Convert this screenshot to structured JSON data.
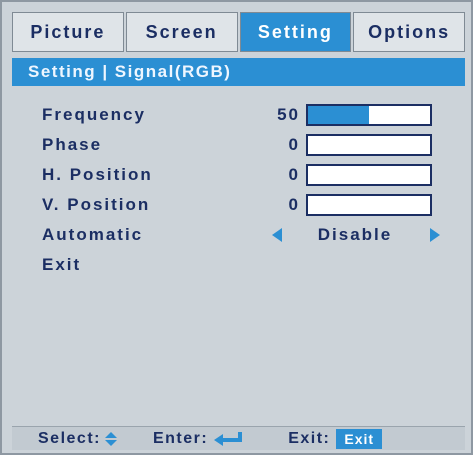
{
  "tabs": [
    {
      "label": "Picture",
      "active": false
    },
    {
      "label": "Screen",
      "active": false
    },
    {
      "label": "Setting",
      "active": true
    },
    {
      "label": "Options",
      "active": false
    }
  ],
  "subheader": "Setting | Signal(RGB)",
  "menu": {
    "frequency": {
      "label": "Frequency",
      "value": "50",
      "fill_percent": 50
    },
    "phase": {
      "label": "Phase",
      "value": "0",
      "fill_percent": 0
    },
    "h_position": {
      "label": "H. Position",
      "value": "0",
      "fill_percent": 0
    },
    "v_position": {
      "label": "V. Position",
      "value": "0",
      "fill_percent": 0
    },
    "automatic": {
      "label": "Automatic",
      "value": "Disable"
    },
    "exit": {
      "label": "Exit"
    }
  },
  "footer": {
    "select_label": "Select:",
    "enter_label": "Enter:",
    "exit_label": "Exit:",
    "exit_badge": "Exit"
  },
  "colors": {
    "accent": "#2b8fd3",
    "text": "#1b2e63",
    "background": "#ccd3d9"
  }
}
